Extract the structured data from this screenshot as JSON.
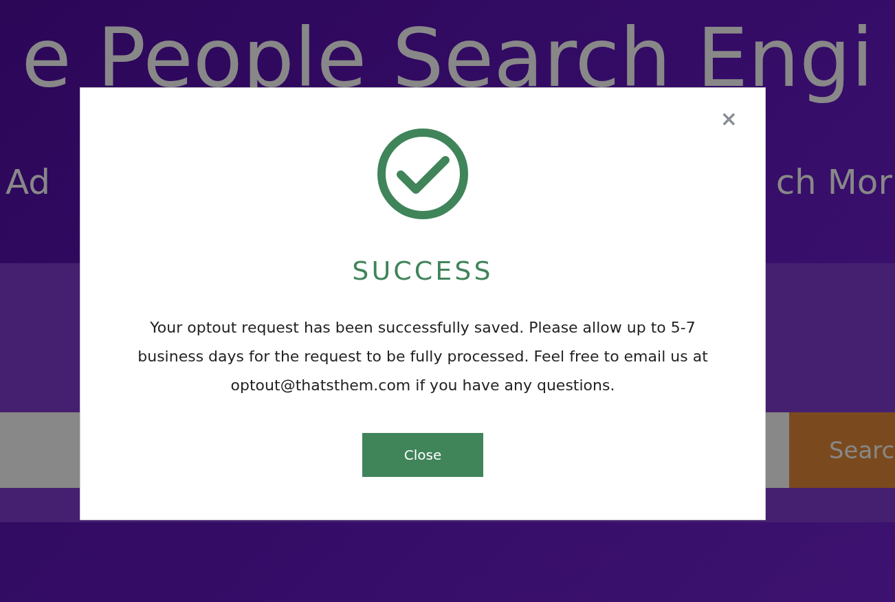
{
  "hero": {
    "title": "e People Search Engi",
    "subtitle_left": "Ad",
    "subtitle_right": "ch Mor"
  },
  "search": {
    "button": "Searc"
  },
  "modal": {
    "title": "SUCCESS",
    "message": "Your optout request has been successfully saved. Please allow up to 5-7 business days for the request to be fully processed. Feel free to email us at optout@thatsthem.com if you have any questions.",
    "close_symbol": "×",
    "button": "Close"
  }
}
